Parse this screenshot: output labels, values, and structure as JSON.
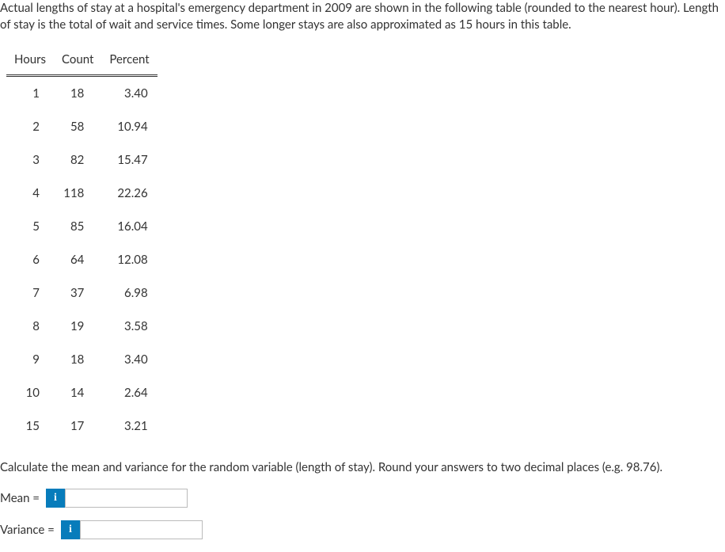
{
  "intro": {
    "line1": "Actual lengths of stay at a hospital's emergency department in 2009 are shown in the following table (rounded to the nearest hour).",
    "line2": "Length of stay is the total of wait and service times. Some longer stays are also approximated as 15 hours in this table."
  },
  "table": {
    "headers": [
      "Hours",
      "Count",
      "Percent"
    ],
    "rows": [
      {
        "hours": "1",
        "count": "18",
        "percent": "3.40"
      },
      {
        "hours": "2",
        "count": "58",
        "percent": "10.94"
      },
      {
        "hours": "3",
        "count": "82",
        "percent": "15.47"
      },
      {
        "hours": "4",
        "count": "118",
        "percent": "22.26"
      },
      {
        "hours": "5",
        "count": "85",
        "percent": "16.04"
      },
      {
        "hours": "6",
        "count": "64",
        "percent": "12.08"
      },
      {
        "hours": "7",
        "count": "37",
        "percent": "6.98"
      },
      {
        "hours": "8",
        "count": "19",
        "percent": "3.58"
      },
      {
        "hours": "9",
        "count": "18",
        "percent": "3.40"
      },
      {
        "hours": "10",
        "count": "14",
        "percent": "2.64"
      },
      {
        "hours": "15",
        "count": "17",
        "percent": "3.21"
      }
    ]
  },
  "instruction": "Calculate the mean and variance for the random variable (length of stay). Round your answers to two decimal places (e.g. 98.76).",
  "answers": {
    "mean_label": "Mean =",
    "variance_label": "Variance =",
    "info_icon": "i",
    "mean_value": "",
    "variance_value": ""
  }
}
